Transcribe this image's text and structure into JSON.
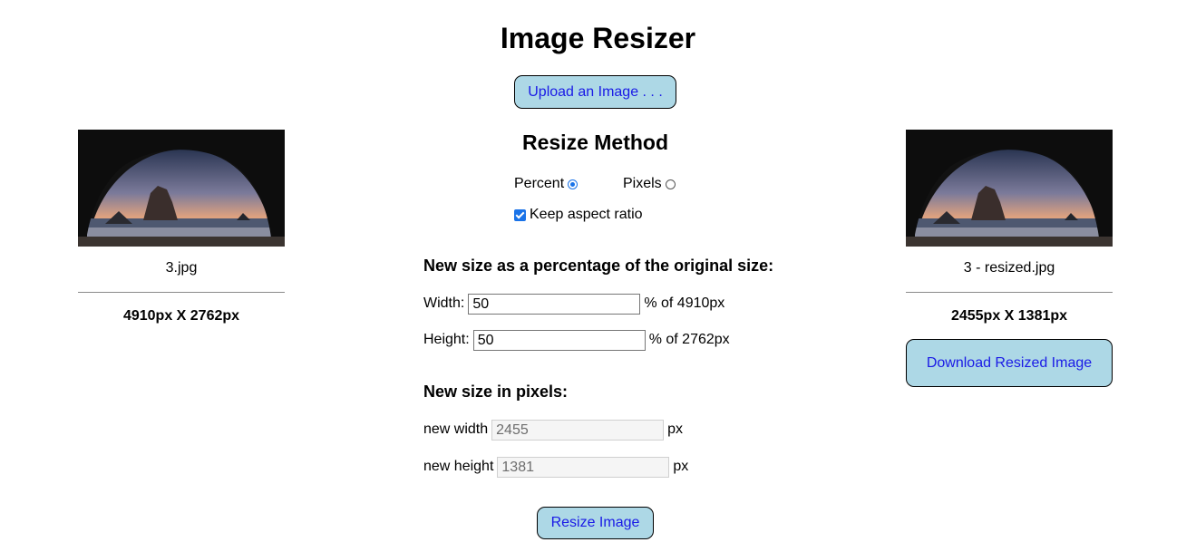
{
  "app": {
    "title": "Image Resizer"
  },
  "upload": {
    "label": "Upload an Image . . ."
  },
  "original": {
    "filename": "3.jpg",
    "dimensions": "4910px X 2762px",
    "image": "landscape-cave-photo"
  },
  "resized": {
    "filename": "3 - resized.jpg",
    "dimensions": "2455px X 1381px",
    "image": "landscape-cave-photo",
    "download_label": "Download Resized Image"
  },
  "method": {
    "title": "Resize Method",
    "percent_label": "Percent",
    "pixels_label": "Pixels",
    "selected": "Percent",
    "keep_aspect_label": "Keep aspect ratio",
    "keep_aspect": true
  },
  "percent": {
    "heading": "New size as a percentage of the original size:",
    "width_label": "Width:",
    "width_value": "50",
    "width_suffix": "% of 4910px",
    "height_label": "Height:",
    "height_value": "50",
    "height_suffix": "% of 2762px"
  },
  "pixels": {
    "heading": "New size in pixels:",
    "width_label": "new width",
    "width_value": "2455",
    "width_suffix": "px",
    "height_label": "new height",
    "height_value": "1381",
    "height_suffix": "px"
  },
  "resize": {
    "label": "Resize Image"
  },
  "colors": {
    "button_bg": "#add8e6",
    "button_text": "#1a1ae6",
    "accent": "#1a73e8"
  }
}
